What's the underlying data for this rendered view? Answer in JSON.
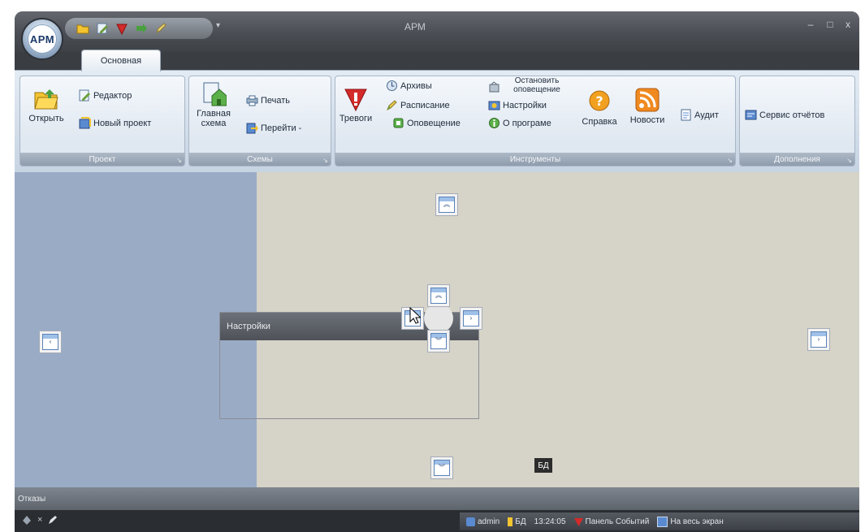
{
  "window": {
    "title": "АРМ",
    "orb_label": "АРМ",
    "minimize": "–",
    "maximize": "□",
    "close": "x",
    "qat_more": "▾"
  },
  "ribbon": {
    "tab_label": "Основная",
    "groups": {
      "project": {
        "label": "Проект",
        "open": "Открыть",
        "editor": "Редактор",
        "new_project": "Новый проект"
      },
      "schemes": {
        "label": "Схемы",
        "main_scheme": "Главная схема",
        "print": "Печать",
        "goto": "Перейти -"
      },
      "tools": {
        "label": "Инструменты",
        "alarms": "Тревоги",
        "archives": "Архивы",
        "schedule": "Расписание",
        "notification": "Оповещение",
        "stop_notification": "Остановить оповещение",
        "settings": "Настройки",
        "about": "О програме",
        "help": "Справка",
        "news": "Новости",
        "audit": "Аудит"
      },
      "addons": {
        "label": "Дополнения",
        "report_service": "Сервис отчётов"
      }
    }
  },
  "workspace": {
    "float_panel_title": "Настройки",
    "bd_badge": "БД",
    "bottom_tab": "Отказы"
  },
  "taskbar": {
    "user": "admin",
    "db": "БД",
    "time": "13:24:05",
    "events_panel": "Панель Событий",
    "fullscreen": "На весь экран"
  },
  "colors": {
    "ribbon_bg": "#dfe7f0",
    "left_pane": "#9aabc6",
    "workspace": "#d6d3c8",
    "frame": "#3a3d42"
  }
}
